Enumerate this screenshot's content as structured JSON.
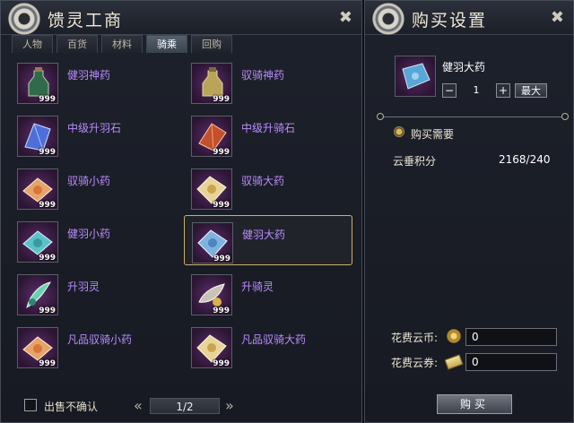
{
  "shop": {
    "title": "馈灵工商",
    "tabs": [
      {
        "label": "人物"
      },
      {
        "label": "百货"
      },
      {
        "label": "材料"
      },
      {
        "label": "骑乘"
      },
      {
        "label": "回购"
      }
    ],
    "active_tab": "骑乘",
    "items": [
      {
        "name": "健羽神药",
        "count": "999",
        "icon": "green-potion-bottle-icon"
      },
      {
        "name": "驭骑神药",
        "count": "999",
        "icon": "yellow-potion-bottle-icon"
      },
      {
        "name": "中级升羽石",
        "count": "999",
        "icon": "blue-crystal-icon"
      },
      {
        "name": "中级升骑石",
        "count": "999",
        "icon": "red-crystal-icon"
      },
      {
        "name": "驭骑小药",
        "count": "999",
        "icon": "orange-powder-pack-icon"
      },
      {
        "name": "驭骑大药",
        "count": "999",
        "icon": "gold-powder-pack-icon"
      },
      {
        "name": "健羽小药",
        "count": "999",
        "icon": "teal-powder-pack-icon"
      },
      {
        "name": "健羽大药",
        "count": "999",
        "icon": "blue-powder-pack-icon"
      },
      {
        "name": "升羽灵",
        "count": "999",
        "icon": "feather-spirit-icon"
      },
      {
        "name": "升骑灵",
        "count": "999",
        "icon": "saddle-spirit-icon"
      },
      {
        "name": "凡品驭骑小药",
        "count": "999",
        "icon": "orange-powder-pack-icon"
      },
      {
        "name": "凡品驭骑大药",
        "count": "999",
        "icon": "gold-powder-pack-icon"
      }
    ],
    "selected_item": "健羽大药",
    "confirm_label": "出售不确认",
    "pager": {
      "text": "1/2",
      "prev": "«",
      "next": "»"
    },
    "tools_glyph": "✖"
  },
  "purchase": {
    "title": "购买设置",
    "item_name": "健羽大药",
    "minus": "−",
    "quantity": "1",
    "plus": "+",
    "max_label": "最大",
    "requirement_label": "购买需要",
    "points_label": "云垂积分",
    "points_value": "2168/240",
    "cost_coin_label": "花费云币:",
    "cost_coin_value": "0",
    "cost_ticket_label": "花费云券:",
    "cost_ticket_value": "0",
    "buy_label": "购买",
    "tools_glyph": "✖"
  },
  "colors": {
    "item_name": "#b98cff",
    "selected_border": "#c9b16a"
  }
}
